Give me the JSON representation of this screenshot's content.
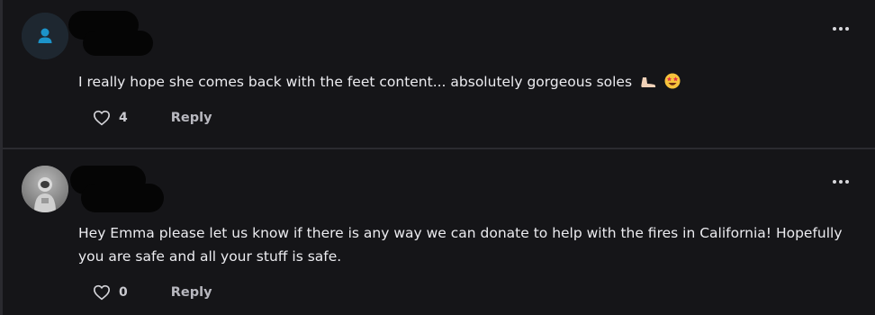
{
  "comments": [
    {
      "avatar_icon": "user-icon",
      "text": "I really hope she comes back with the feet content... absolutely gorgeous soles",
      "emojis": [
        "foot-emoji",
        "star-struck-emoji"
      ],
      "likes": "4",
      "reply_label": "Reply",
      "menu_icon": "more-horizontal-icon"
    },
    {
      "avatar_icon": "astronaut-avatar",
      "text": "Hey Emma please let us know if there is any way we can donate to help with the fires in California! Hopefully you are safe and all your stuff is safe.",
      "likes": "0",
      "reply_label": "Reply",
      "menu_icon": "more-horizontal-icon"
    }
  ],
  "colors": {
    "background": "#151518",
    "divider": "#2b2b30",
    "avatar_icon_color": "#1c93c9",
    "text": "#ececf0",
    "muted": "#b8b8bf"
  }
}
